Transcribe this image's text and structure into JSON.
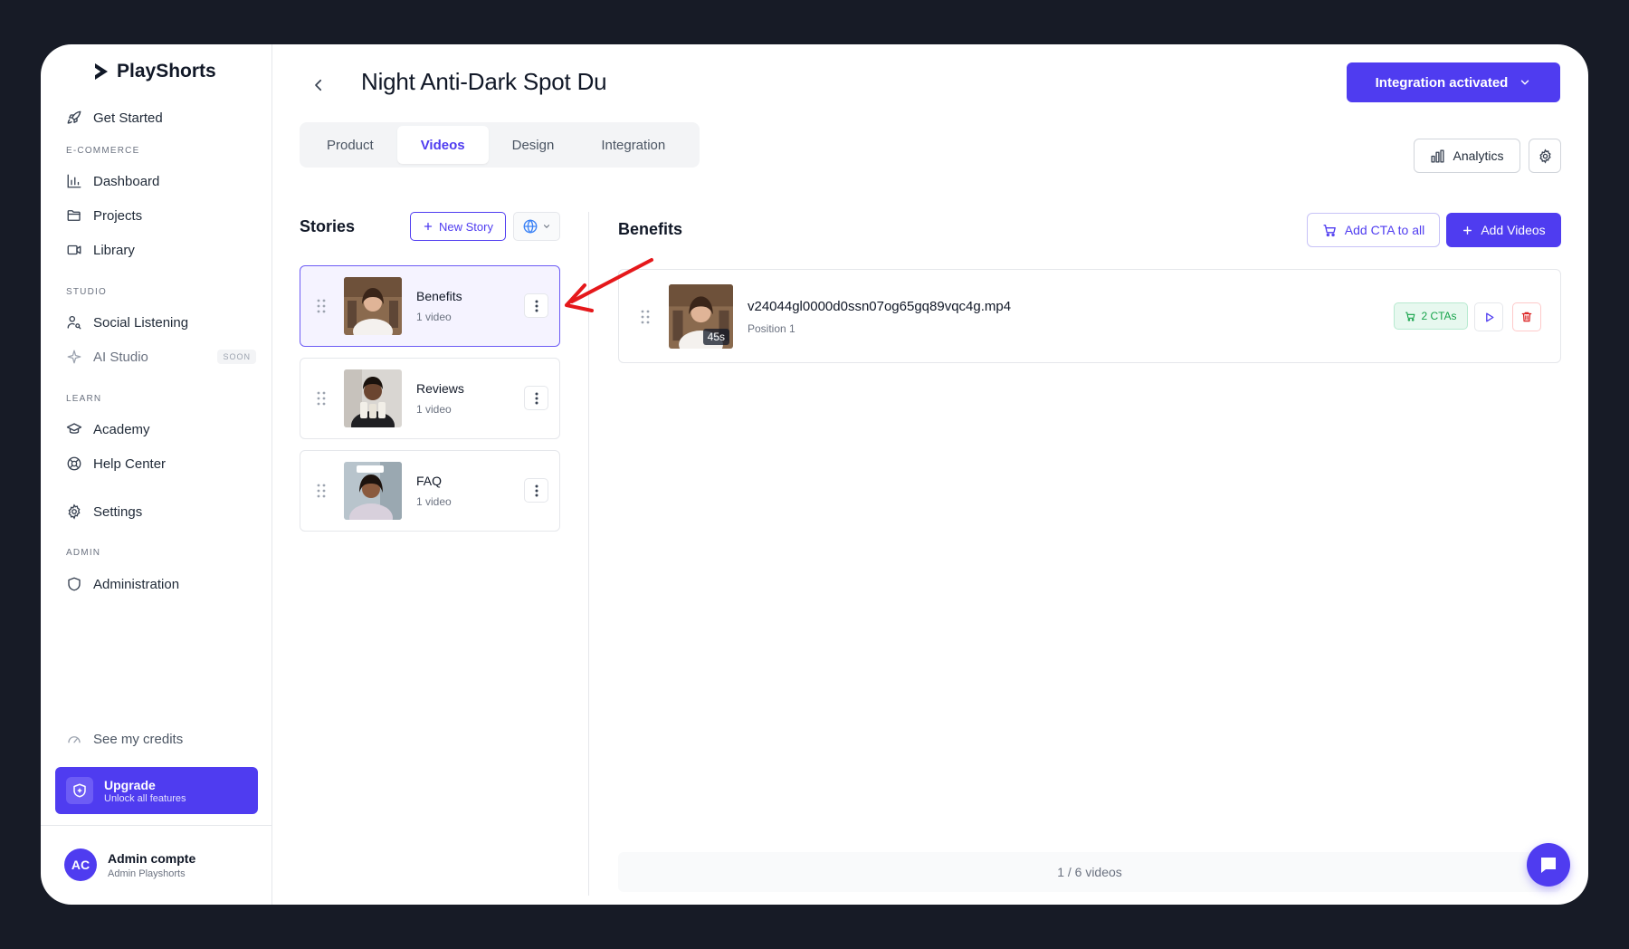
{
  "brand": {
    "name": "PlayShorts"
  },
  "sidebar": {
    "get_started": "Get Started",
    "sections": {
      "ecommerce": "E-COMMERCE",
      "studio": "STUDIO",
      "learn": "LEARN",
      "admin": "ADMIN"
    },
    "items": {
      "dashboard": "Dashboard",
      "projects": "Projects",
      "library": "Library",
      "social_listening": "Social Listening",
      "ai_studio": "AI Studio",
      "ai_studio_badge": "SOON",
      "academy": "Academy",
      "help_center": "Help Center",
      "settings": "Settings",
      "administration": "Administration"
    },
    "credits": "See my credits",
    "upgrade": {
      "title": "Upgrade",
      "subtitle": "Unlock all features"
    },
    "user": {
      "initials": "AC",
      "name": "Admin compte",
      "role": "Admin Playshorts"
    }
  },
  "header": {
    "title": "Night Anti-Dark Spot Du",
    "integration_button": "Integration activated",
    "analytics_button": "Analytics"
  },
  "tabs": [
    {
      "label": "Product",
      "active": false
    },
    {
      "label": "Videos",
      "active": true
    },
    {
      "label": "Design",
      "active": false
    },
    {
      "label": "Integration",
      "active": false
    }
  ],
  "stories": {
    "title": "Stories",
    "new_story": "New Story",
    "items": [
      {
        "name": "Benefits",
        "count": "1 video",
        "selected": true
      },
      {
        "name": "Reviews",
        "count": "1 video",
        "selected": false
      },
      {
        "name": "FAQ",
        "count": "1 video",
        "selected": false
      }
    ]
  },
  "panel": {
    "title": "Benefits",
    "add_cta_all": "Add CTA to all",
    "add_videos": "Add Videos",
    "videos": [
      {
        "filename": "v24044gl0000d0ssn07og65gq89vqc4g.mp4",
        "position": "Position 1",
        "duration": "45s",
        "ctas": "2 CTAs"
      }
    ],
    "footer": "1 / 6 videos"
  },
  "colors": {
    "accent": "#4f3cf0",
    "success": "#16a34a",
    "danger": "#dc2626",
    "annotation": "#e5181b"
  },
  "icons": [
    "playshorts-logo-icon",
    "rocket-icon",
    "bar-chart-icon",
    "folder-icon",
    "video-camera-icon",
    "user-search-icon",
    "sparkle-icon",
    "graduation-cap-icon",
    "lifebuoy-icon",
    "gear-icon",
    "shield-icon",
    "gauge-icon",
    "chevron-left-icon",
    "chevron-down-icon",
    "plus-icon",
    "globe-icon",
    "drag-handle-icon",
    "kebab-icon",
    "cart-icon",
    "play-icon",
    "trash-icon",
    "chat-icon"
  ]
}
